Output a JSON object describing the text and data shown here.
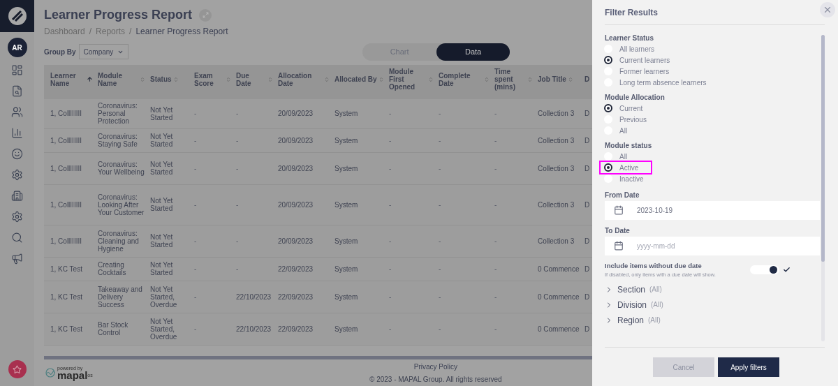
{
  "sidebar": {
    "avatar": "AR"
  },
  "page": {
    "title": "Learner Progress Report",
    "breadcrumbs": [
      {
        "kind": "link",
        "label": "Dashboard"
      },
      {
        "kind": "separator",
        "label": "/"
      },
      {
        "kind": "link",
        "label": "Reports"
      },
      {
        "kind": "separator",
        "label": "/"
      },
      {
        "kind": "current",
        "label": "Learner Progress Report"
      }
    ],
    "group_by": {
      "label": "Group By",
      "value": "Company"
    },
    "view_tabs": [
      {
        "label": "Chart",
        "selected": false
      },
      {
        "label": "Data",
        "selected": true
      }
    ]
  },
  "table": {
    "columns": [
      {
        "label": "Learner Name",
        "sorted": true
      },
      {
        "label": "Module Name",
        "sorted": false
      },
      {
        "label": "Status",
        "sorted": false
      },
      {
        "label": "Exam Score",
        "sorted": false
      },
      {
        "label": "Due Date",
        "sorted": false
      },
      {
        "label": "Allocation Date",
        "sorted": false
      },
      {
        "label": "Allocated By",
        "sorted": false
      },
      {
        "label": "Module First Opened",
        "sorted": false
      },
      {
        "label": "Complete Date",
        "sorted": false
      },
      {
        "label": "Time spent (mins)",
        "sorted": false
      },
      {
        "label": "Job Title",
        "sorted": false
      },
      {
        "label": "D"
      }
    ],
    "rows": [
      [
        "1, CollIIIIII",
        "Coronavirus: Personal Protection",
        "Not Yet Started",
        "-",
        "-",
        "20/09/2023",
        "System",
        "-",
        "-",
        "-",
        "Collection 3",
        "D"
      ],
      [
        "1, CollIIIIII",
        "Coronavirus: Staying Safe",
        "Not Yet Started",
        "-",
        "-",
        "20/09/2023",
        "System",
        "-",
        "-",
        "-",
        "Collection 3",
        "D"
      ],
      [
        "1, CollIIIIII",
        "Coronavirus: Your Wellbeing",
        "Not Yet Started",
        "-",
        "-",
        "20/09/2023",
        "System",
        "-",
        "-",
        "-",
        "Collection 3",
        "D"
      ],
      [
        "1, CollIIIIII",
        "Coronavirus: Looking After Your Customer",
        "Not Yet Started",
        "-",
        "-",
        "20/09/2023",
        "System",
        "-",
        "-",
        "-",
        "Collection 3",
        "D"
      ],
      [
        "1, CollIIIIII",
        "Coronavirus: Cleaning and Hygiene",
        "Not Yet Started",
        "-",
        "-",
        "20/09/2023",
        "System",
        "-",
        "-",
        "-",
        "Collection 3",
        "D"
      ],
      [
        "1, KC Test",
        "Creating Cocktails",
        "Not Yet Started",
        "-",
        "-",
        "22/09/2023",
        "System",
        "-",
        "-",
        "-",
        "0 Commence",
        "D"
      ],
      [
        "1, KC Test",
        "Takeaway and Delivery Success",
        "Not Yet Started, Overdue",
        "-",
        "22/10/2023",
        "22/09/2023",
        "System",
        "-",
        "-",
        "-",
        "0 Commence",
        "D"
      ],
      [
        "1, KC Test",
        "Bar Stock Control",
        "Not Yet Started, Overdue",
        "-",
        "22/10/2023",
        "22/09/2023",
        "System",
        "-",
        "-",
        "-",
        "0 Commence",
        "D"
      ]
    ]
  },
  "footer": {
    "powered_by": "powered by",
    "brand": "mapal",
    "brand_suffix": "os",
    "link": "Privacy Policy",
    "copyright": "© 2023 - MAPAL Group. All rights reserved"
  },
  "filter_panel": {
    "title": "Filter Results",
    "groups": [
      {
        "title": "Learner Status",
        "options": [
          {
            "label": "All learners",
            "selected": false,
            "highlighted": false
          },
          {
            "label": "Current learners",
            "selected": true,
            "highlighted": false
          },
          {
            "label": "Former learners",
            "selected": false,
            "highlighted": false
          },
          {
            "label": "Long term absence learners",
            "selected": false,
            "highlighted": false
          }
        ]
      },
      {
        "title": "Module Allocation",
        "options": [
          {
            "label": "Current",
            "selected": true,
            "highlighted": false
          },
          {
            "label": "Previous",
            "selected": false,
            "highlighted": false
          },
          {
            "label": "All",
            "selected": false,
            "highlighted": false
          }
        ]
      },
      {
        "title": "Module status",
        "options": [
          {
            "label": "All",
            "selected": false,
            "highlighted": false
          },
          {
            "label": "Active",
            "selected": true,
            "highlighted": true
          },
          {
            "label": "Inactive",
            "selected": false,
            "highlighted": false
          }
        ]
      }
    ],
    "dates": [
      {
        "label": "From Date",
        "value": "2023-10-19"
      },
      {
        "label": "To Date",
        "placeholder": "yyyy-mm-dd"
      }
    ],
    "toggle": {
      "label": "Include items without due date",
      "hint": "If disabled, only items with a due date will show.",
      "on": true
    },
    "sections": [
      {
        "label": "Section",
        "value": "(All)",
        "expanded": false
      },
      {
        "label": "Division",
        "value": "(All)",
        "expanded": false
      },
      {
        "label": "Region",
        "value": "(All)",
        "expanded": false
      }
    ],
    "buttons": {
      "cancel": "Cancel",
      "apply": "Apply filters"
    }
  }
}
